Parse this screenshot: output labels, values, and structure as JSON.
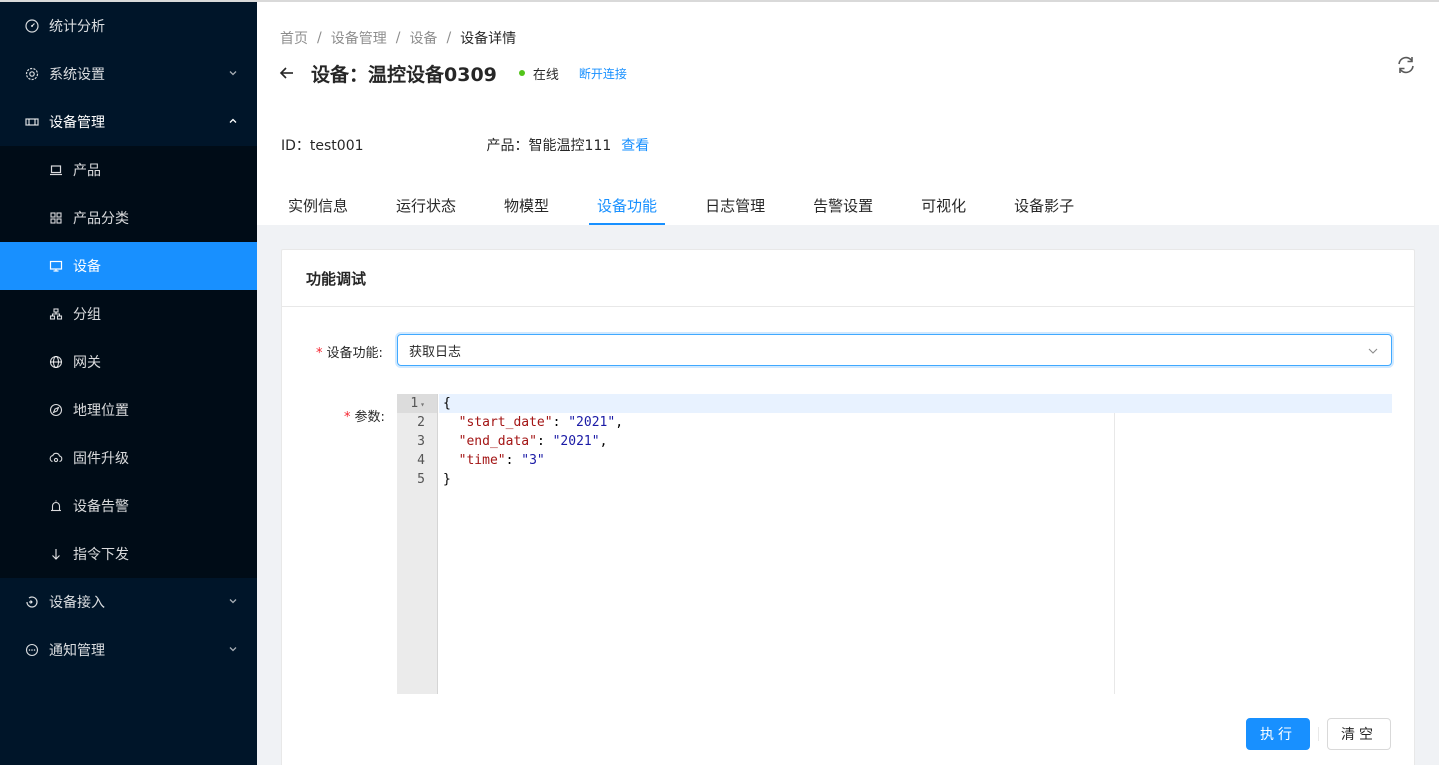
{
  "sidebar": {
    "items": [
      {
        "label": "统计分析",
        "icon": "dashboard-icon"
      },
      {
        "label": "系统设置",
        "icon": "gear-icon"
      },
      {
        "label": "设备管理",
        "icon": "device-manage-icon"
      },
      {
        "label": "设备接入",
        "icon": "access-icon"
      },
      {
        "label": "通知管理",
        "icon": "message-icon"
      }
    ],
    "sub": [
      {
        "label": "产品",
        "icon": "laptop-icon"
      },
      {
        "label": "产品分类",
        "icon": "apps-icon"
      },
      {
        "label": "设备",
        "icon": "monitor-icon"
      },
      {
        "label": "分组",
        "icon": "cluster-icon"
      },
      {
        "label": "网关",
        "icon": "globe-icon"
      },
      {
        "label": "地理位置",
        "icon": "compass-icon"
      },
      {
        "label": "固件升级",
        "icon": "cloud-sync-icon"
      },
      {
        "label": "设备告警",
        "icon": "alarm-icon"
      },
      {
        "label": "指令下发",
        "icon": "arrow-down-icon"
      }
    ]
  },
  "breadcrumb": [
    "首页",
    "设备管理",
    "设备",
    "设备详情"
  ],
  "header": {
    "title": "设备：温控设备0309",
    "status": "在线",
    "status_color": "#52c41a",
    "disconnect": "断开连接",
    "id_label": "ID：test001",
    "product_label": "产品：智能温控111",
    "view_link": "查看"
  },
  "tabs": [
    "实例信息",
    "运行状态",
    "物模型",
    "设备功能",
    "日志管理",
    "告警设置",
    "可视化",
    "设备影子"
  ],
  "active_tab": "设备功能",
  "card": {
    "title": "功能调试",
    "function_label": "设备功能:",
    "function_value": "获取日志",
    "params_label": "参数:",
    "editor_lines": [
      "1",
      "2",
      "3",
      "4",
      "5"
    ],
    "execute": "执行",
    "clear": "清空"
  },
  "accent": "#1890ff"
}
